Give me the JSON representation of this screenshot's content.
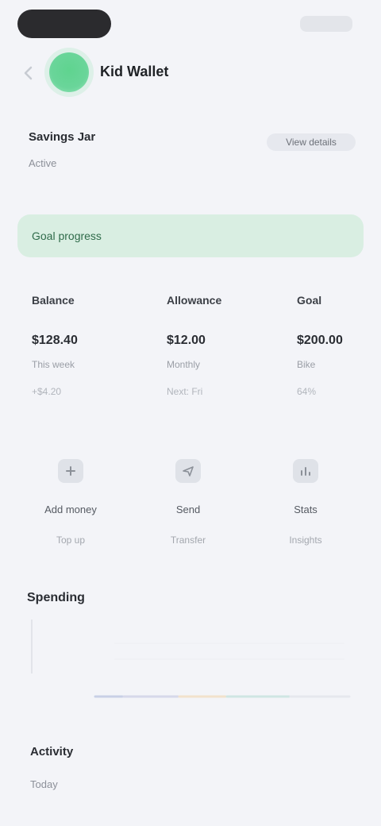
{
  "header": {
    "title": "Kid Wallet",
    "back_icon": "chevron-left-icon"
  },
  "account": {
    "name": "Savings Jar",
    "sub": "Active",
    "link_label": "View details"
  },
  "banner": {
    "text": "Goal progress"
  },
  "stats": [
    {
      "heading": "Balance",
      "value": "$128.40",
      "sub": "This week",
      "tiny": "+$4.20"
    },
    {
      "heading": "Allowance",
      "value": "$12.00",
      "sub": "Monthly",
      "tiny": "Next: Fri"
    },
    {
      "heading": "Goal",
      "value": "$200.00",
      "sub": "Bike",
      "tiny": "64%"
    }
  ],
  "quick_actions": [
    {
      "icon": "plus-icon",
      "label": "Add money",
      "sub": "Top up"
    },
    {
      "icon": "send-icon",
      "label": "Send",
      "sub": "Transfer"
    },
    {
      "icon": "chart-icon",
      "label": "Stats",
      "sub": "Insights"
    }
  ],
  "section": {
    "title": "Spending"
  },
  "bottom": {
    "title": "Activity",
    "sub": "Today"
  },
  "colors": {
    "accent": "#5fd48f",
    "banner_bg": "#d9eee2",
    "page_bg": "#f3f4f8"
  }
}
